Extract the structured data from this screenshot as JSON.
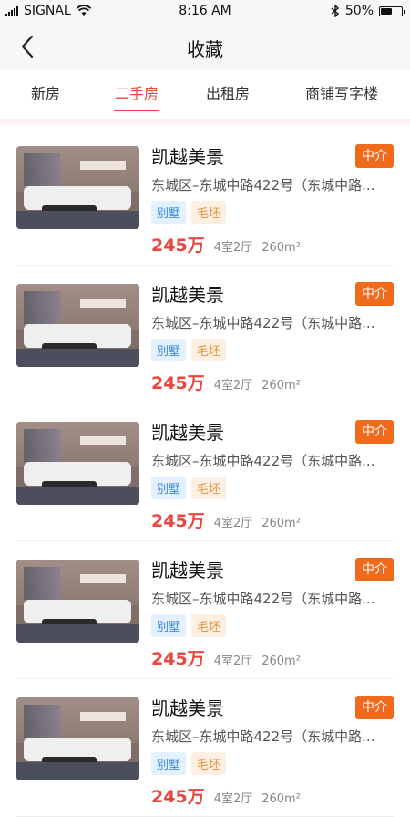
{
  "status_bar": {
    "carrier": "SIGNAL",
    "time": "8:16 AM",
    "battery": "50%",
    "battery_level": 0.5
  },
  "nav": {
    "title": "收藏",
    "back_icon": "chevron-left-icon"
  },
  "tabs": [
    {
      "label": "新房"
    },
    {
      "label": "二手房",
      "active": true
    },
    {
      "label": "出租房"
    },
    {
      "label": "商铺写字楼"
    }
  ],
  "listings": [
    {
      "title": "凯越美景",
      "badge": "中介",
      "address": "东城区–东城中路422号（东城中路...",
      "tags": [
        "别墅",
        "毛坯"
      ],
      "price": "245万",
      "layout": "4室2厅",
      "area": "260m²"
    },
    {
      "title": "凯越美景",
      "badge": "中介",
      "address": "东城区–东城中路422号（东城中路...",
      "tags": [
        "别墅",
        "毛坯"
      ],
      "price": "245万",
      "layout": "4室2厅",
      "area": "260m²"
    },
    {
      "title": "凯越美景",
      "badge": "中介",
      "address": "东城区–东城中路422号（东城中路...",
      "tags": [
        "别墅",
        "毛坯"
      ],
      "price": "245万",
      "layout": "4室2厅",
      "area": "260m²"
    },
    {
      "title": "凯越美景",
      "badge": "中介",
      "address": "东城区–东城中路422号（东城中路...",
      "tags": [
        "别墅",
        "毛坯"
      ],
      "price": "245万",
      "layout": "4室2厅",
      "area": "260m²"
    },
    {
      "title": "凯越美景",
      "badge": "中介",
      "address": "东城区–东城中路422号（东城中路...",
      "tags": [
        "别墅",
        "毛坯"
      ],
      "price": "245万",
      "layout": "4室2厅",
      "area": "260m²"
    }
  ],
  "colors": {
    "accent": "#e8473d",
    "badge": "#f06a1c"
  }
}
